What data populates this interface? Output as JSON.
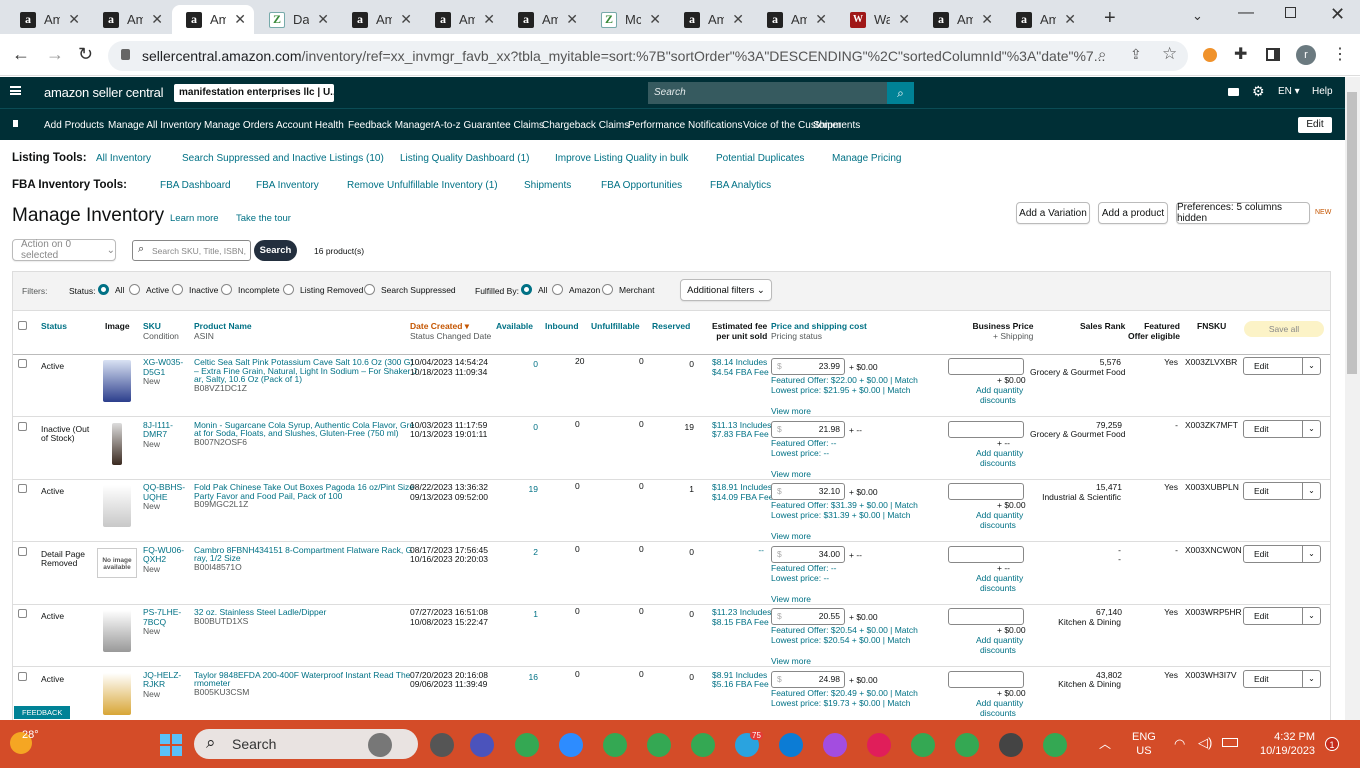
{
  "browser": {
    "tabs": [
      {
        "label": "Am",
        "icon": "amazon-icon"
      },
      {
        "label": "Am",
        "icon": "amazon-icon"
      },
      {
        "label": "Am",
        "icon": "amazon-icon",
        "active": true
      },
      {
        "label": "Da",
        "icon": "zen-icon"
      },
      {
        "label": "Am",
        "icon": "amazon-icon"
      },
      {
        "label": "Am",
        "icon": "amazon-icon"
      },
      {
        "label": "Am",
        "icon": "amazon-icon"
      },
      {
        "label": "Mc",
        "icon": "zen-icon"
      },
      {
        "label": "Am",
        "icon": "amazon-icon"
      },
      {
        "label": "Am",
        "icon": "amazon-icon"
      },
      {
        "label": "Wa",
        "icon": "w-icon"
      },
      {
        "label": "Am",
        "icon": "amazon-icon"
      },
      {
        "label": "Am",
        "icon": "amazon-icon"
      }
    ],
    "url_host": "sellercentral.amazon.com",
    "url_path": "/inventory/ref=xx_invmgr_favb_xx?tbla_myitable=sort:%7B\"sortOrder\"%3A\"DESCENDING\"%2C\"sortedColumnId\"%3A\"date\"%7...",
    "profile": "r"
  },
  "header": {
    "logo": "amazon seller central",
    "account": "manifestation enterprises llc | U...",
    "search_placeholder": "Search",
    "lang": "EN",
    "help": "Help"
  },
  "nav": {
    "items": [
      "Add Products",
      "Manage All Inventory",
      "Manage Orders",
      "Account Health",
      "Feedback Manager",
      "A-to-z Guarantee Claims",
      "Chargeback Claims",
      "Performance Notifications",
      "Voice of the Customer",
      "Shipments"
    ],
    "edit": "Edit"
  },
  "listing_tools": {
    "label": "Listing Tools:",
    "items": [
      "All Inventory",
      "Search Suppressed and Inactive Listings (10)",
      "Listing Quality Dashboard (1)",
      "Improve Listing Quality in bulk",
      "Potential Duplicates",
      "Manage Pricing"
    ]
  },
  "fba_tools": {
    "label": "FBA Inventory Tools:",
    "items": [
      "FBA Dashboard",
      "FBA Inventory",
      "Remove Unfulfillable Inventory (1)",
      "Shipments",
      "FBA Opportunities",
      "FBA Analytics"
    ]
  },
  "page": {
    "title": "Manage Inventory",
    "learn_more": "Learn more",
    "tour": "Take the tour",
    "add_variation": "Add a Variation",
    "add_product": "Add a product",
    "preferences": "Preferences: 5 columns hidden",
    "new_badge": "NEW",
    "action": "Action on 0 selected",
    "search_placeholder": "Search SKU, Title, ISBN,",
    "search_btn": "Search",
    "count": "16 product(s)"
  },
  "filters": {
    "label": "Filters:",
    "status_label": "Status:",
    "status": [
      "All",
      "Active",
      "Inactive",
      "Incomplete",
      "Listing Removed",
      "Search Suppressed"
    ],
    "fulfilled_label": "Fulfilled By:",
    "fulfilled": [
      "All",
      "Amazon",
      "Merchant"
    ],
    "additional": "Additional filters"
  },
  "columns": {
    "status": "Status",
    "image": "Image",
    "sku": "SKU",
    "condition": "Condition",
    "product": "Product Name",
    "asin": "ASIN",
    "date": "Date Created",
    "date_sub": "Status Changed Date",
    "available": "Available",
    "inbound": "Inbound",
    "unfulfillable": "Unfulfillable",
    "reserved": "Reserved",
    "fee": "Estimated fee",
    "fee_sub": "per unit sold",
    "price": "Price and shipping cost",
    "price_sub": "Pricing status",
    "business": "Business Price",
    "business_sub": "+ Shipping",
    "rank": "Sales Rank",
    "featured": "Featured",
    "featured_sub": "Offer eligible",
    "fnsku": "FNSKU",
    "save_all": "Save all"
  },
  "rows": [
    {
      "status": "Active",
      "sku1": "XG-W035-",
      "sku2": "D5G1",
      "cond": "New",
      "name": [
        "Celtic Sea Salt Pink Potassium Cave Salt 10.6 Oz (300 G)",
        "– Extra Fine Grain, Natural, Light In Sodium – For Shaker J",
        "ar, Salty, 10.6 Oz (Pack of 1)"
      ],
      "asin": "B08VZ1DC1Z",
      "date": "10/04/2023 14:54:24",
      "date2": "10/18/2023 11:09:34",
      "available": "0",
      "inbound": "20",
      "unful": "0",
      "reserved": "0",
      "fee1": "$8.14 Includes",
      "fee2": "$4.54 FBA Fee",
      "price": "23.99",
      "ship": "+ $0.00",
      "feat": "Featured Offer: $22.00 + $0.00 | Match",
      "low": "Lowest price: $21.95 + $0.00 | Match",
      "view": "View more",
      "bship": "+ $0.00",
      "addq": "Add quantity",
      "disc": "discounts",
      "rank": "5,576",
      "cat": "Grocery & Gourmet Food",
      "featured": "Yes",
      "fnsku": "X003ZLVXBR",
      "edit": "Edit"
    },
    {
      "status": "Inactive (Out",
      "status2": "of Stock)",
      "sku1": "8J-I111-",
      "sku2": "DMR7",
      "cond": "New",
      "name": [
        "Monin - Sugarcane Cola Syrup, Authentic Cola Flavor, Gre",
        "at for Soda, Floats, and Slushes, Gluten-Free (750 ml)"
      ],
      "asin": "B007N2OSF6",
      "date": "10/03/2023 11:17:59",
      "date2": "10/13/2023 19:01:11",
      "available": "0",
      "inbound": "0",
      "unful": "0",
      "reserved": "19",
      "fee1": "$11.13 Includes",
      "fee2": "$7.83 FBA Fee",
      "price": "21.98",
      "ship": "+ --",
      "feat": "Featured Offer: --",
      "low": "Lowest price: --",
      "view": "View more",
      "bship": "+ --",
      "addq": "Add quantity",
      "disc": "discounts",
      "rank": "79,259",
      "cat": "Grocery & Gourmet Food",
      "featured": "-",
      "fnsku": "X003ZK7MFT",
      "edit": "Edit"
    },
    {
      "status": "Active",
      "sku1": "QQ-BBHS-",
      "sku2": "UQHE",
      "cond": "New",
      "name": [
        "Fold Pak Chinese Take Out Boxes Pagoda 16 oz/Pint Size",
        "Party Favor and Food Pail, Pack of 100"
      ],
      "asin": "B09MGC2L1Z",
      "date": "08/22/2023 13:36:32",
      "date2": "09/13/2023 09:52:00",
      "available": "19",
      "inbound": "0",
      "unful": "0",
      "reserved": "1",
      "fee1": "$18.91 Includes",
      "fee2": "$14.09 FBA Fee",
      "price": "32.10",
      "ship": "+ $0.00",
      "feat": "Featured Offer: $31.39 + $0.00 | Match",
      "low": "Lowest price: $31.39 + $0.00 | Match",
      "view": "View more",
      "bship": "+ $0.00",
      "addq": "Add quantity",
      "disc": "discounts",
      "rank": "15,471",
      "cat": "Industrial & Scientific",
      "featured": "Yes",
      "fnsku": "X003XUBPLN",
      "edit": "Edit"
    },
    {
      "status": "Detail Page",
      "status2": "Removed",
      "sku1": "FQ-WU06-",
      "sku2": "QXH2",
      "cond": "New",
      "name": [
        "Cambro 8FBNH434151 8-Compartment Flatware Rack, G",
        "ray, 1/2 Size"
      ],
      "asin": "B00I48571O",
      "date": "08/17/2023 17:56:45",
      "date2": "10/16/2023 20:20:03",
      "available": "2",
      "inbound": "0",
      "unful": "0",
      "reserved": "0",
      "fee1": "--",
      "fee2": "",
      "price": "34.00",
      "ship": "+ --",
      "feat": "Featured Offer: --",
      "low": "Lowest price: --",
      "view": "View more",
      "bship": "+ --",
      "addq": "Add quantity",
      "disc": "discounts",
      "rank": "-",
      "cat": "-",
      "featured": "-",
      "fnsku": "X003XNCW0N",
      "edit": "Edit",
      "noimage": "No image available"
    },
    {
      "status": "Active",
      "sku1": "PS-7LHE-",
      "sku2": "7BCQ",
      "cond": "New",
      "name": [
        "32 oz. Stainless Steel Ladle/Dipper"
      ],
      "asin": "B00BUTD1XS",
      "date": "07/27/2023 16:51:08",
      "date2": "10/08/2023 15:22:47",
      "available": "1",
      "inbound": "0",
      "unful": "0",
      "reserved": "0",
      "fee1": "$11.23 Includes",
      "fee2": "$8.15 FBA Fee",
      "price": "20.55",
      "ship": "+ $0.00",
      "feat": "Featured Offer: $20.54 + $0.00 | Match",
      "low": "Lowest price: $20.54 + $0.00 | Match",
      "view": "View more",
      "bship": "+ $0.00",
      "addq": "Add quantity",
      "disc": "discounts",
      "rank": "67,140",
      "cat": "Kitchen & Dining",
      "featured": "Yes",
      "fnsku": "X003WRP5HR",
      "edit": "Edit"
    },
    {
      "status": "Active",
      "sku1": "JQ-HELZ-",
      "sku2": "RJKR",
      "cond": "New",
      "name": [
        "Taylor 9848EFDA 200-400F Waterproof Instant Read The",
        "rmometer"
      ],
      "asin": "B005KU3CSM",
      "date": "07/20/2023 20:16:08",
      "date2": "09/06/2023 11:39:49",
      "available": "16",
      "inbound": "0",
      "unful": "0",
      "reserved": "0",
      "fee1": "$8.91 Includes",
      "fee2": "$5.16 FBA Fee",
      "price": "24.98",
      "ship": "+ $0.00",
      "feat": "Featured Offer: $20.49 + $0.00 | Match",
      "low": "Lowest price: $19.73 + $0.00 | Match",
      "view": "View more",
      "bship": "+ $0.00",
      "addq": "Add quantity",
      "disc": "discounts",
      "rank": "43,802",
      "cat": "Kitchen & Dining",
      "featured": "Yes",
      "fnsku": "X003WH3I7V",
      "edit": "Edit"
    }
  ],
  "feedback": "FEEDBACK",
  "taskbar": {
    "temp": "28°",
    "search": "Search",
    "lang1": "ENG",
    "lang2": "US",
    "time": "4:32 PM",
    "date": "10/19/2023",
    "badge": "1",
    "telegram_badge": "75"
  }
}
